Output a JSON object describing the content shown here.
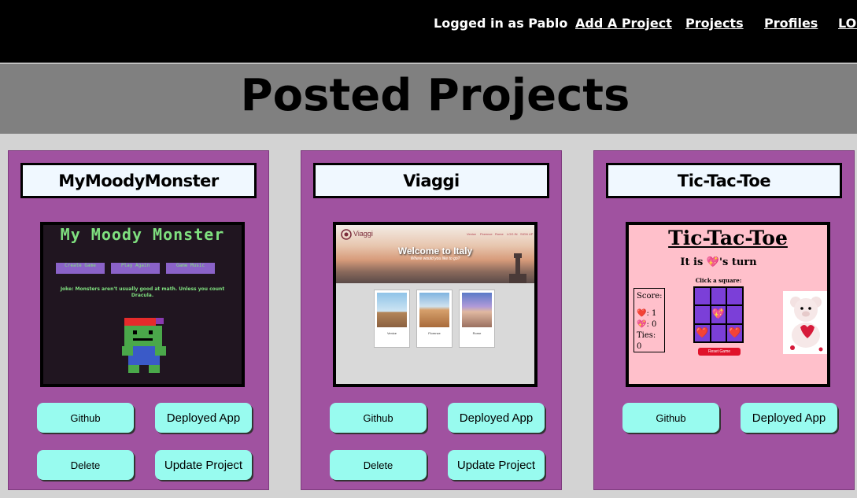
{
  "nav": {
    "user": "Logged in as Pablo",
    "links": [
      "Add A Project",
      "Projects",
      "Profiles",
      "LOG"
    ]
  },
  "page": {
    "title": "Posted Projects"
  },
  "projects": [
    {
      "title": "MyMoodyMonster",
      "buttons": {
        "github": "Github",
        "deployed": "Deployed App",
        "delete": "Delete",
        "update": "Update Project"
      },
      "preview": {
        "title": "My Moody Monster",
        "buttons": [
          "Create Game",
          "Play Again",
          "Game Music"
        ],
        "joke": "Joke: Monsters aren't usually good at math. Unless you count Dracula."
      }
    },
    {
      "title": "Viaggi",
      "buttons": {
        "github": "Github",
        "deployed": "Deployed App",
        "delete": "Delete",
        "update": "Update Project"
      },
      "preview": {
        "logo": "Viaggi",
        "nav": [
          "Venice",
          "Florence",
          "Rome",
          "LOG IN",
          "SIGN UP"
        ],
        "welcome": "Welcome to Italy",
        "subtitle": "Where would you like to go?",
        "cities": [
          "Venice",
          "Florence",
          "Rome"
        ]
      }
    },
    {
      "title": "Tic-Tac-Toe",
      "buttons": {
        "github": "Github",
        "deployed": "Deployed App"
      },
      "preview": {
        "title": "Tic-Tac-Toe",
        "turn": "It is 💖's turn",
        "click": "Click a square:",
        "score_label": "Score:",
        "score_heart": ": 1",
        "score_sparkle": ": 0",
        "ties": "Ties: 0",
        "cells": [
          "",
          "",
          "",
          "",
          "💖",
          "",
          "❤️",
          "",
          "❤️"
        ],
        "reset": "Reset Game"
      }
    }
  ],
  "colors": {
    "card": "#a052a0",
    "button": "#98fbef",
    "title_box": "#f0f8ff",
    "nav": "#000000",
    "title_band": "#808080"
  }
}
